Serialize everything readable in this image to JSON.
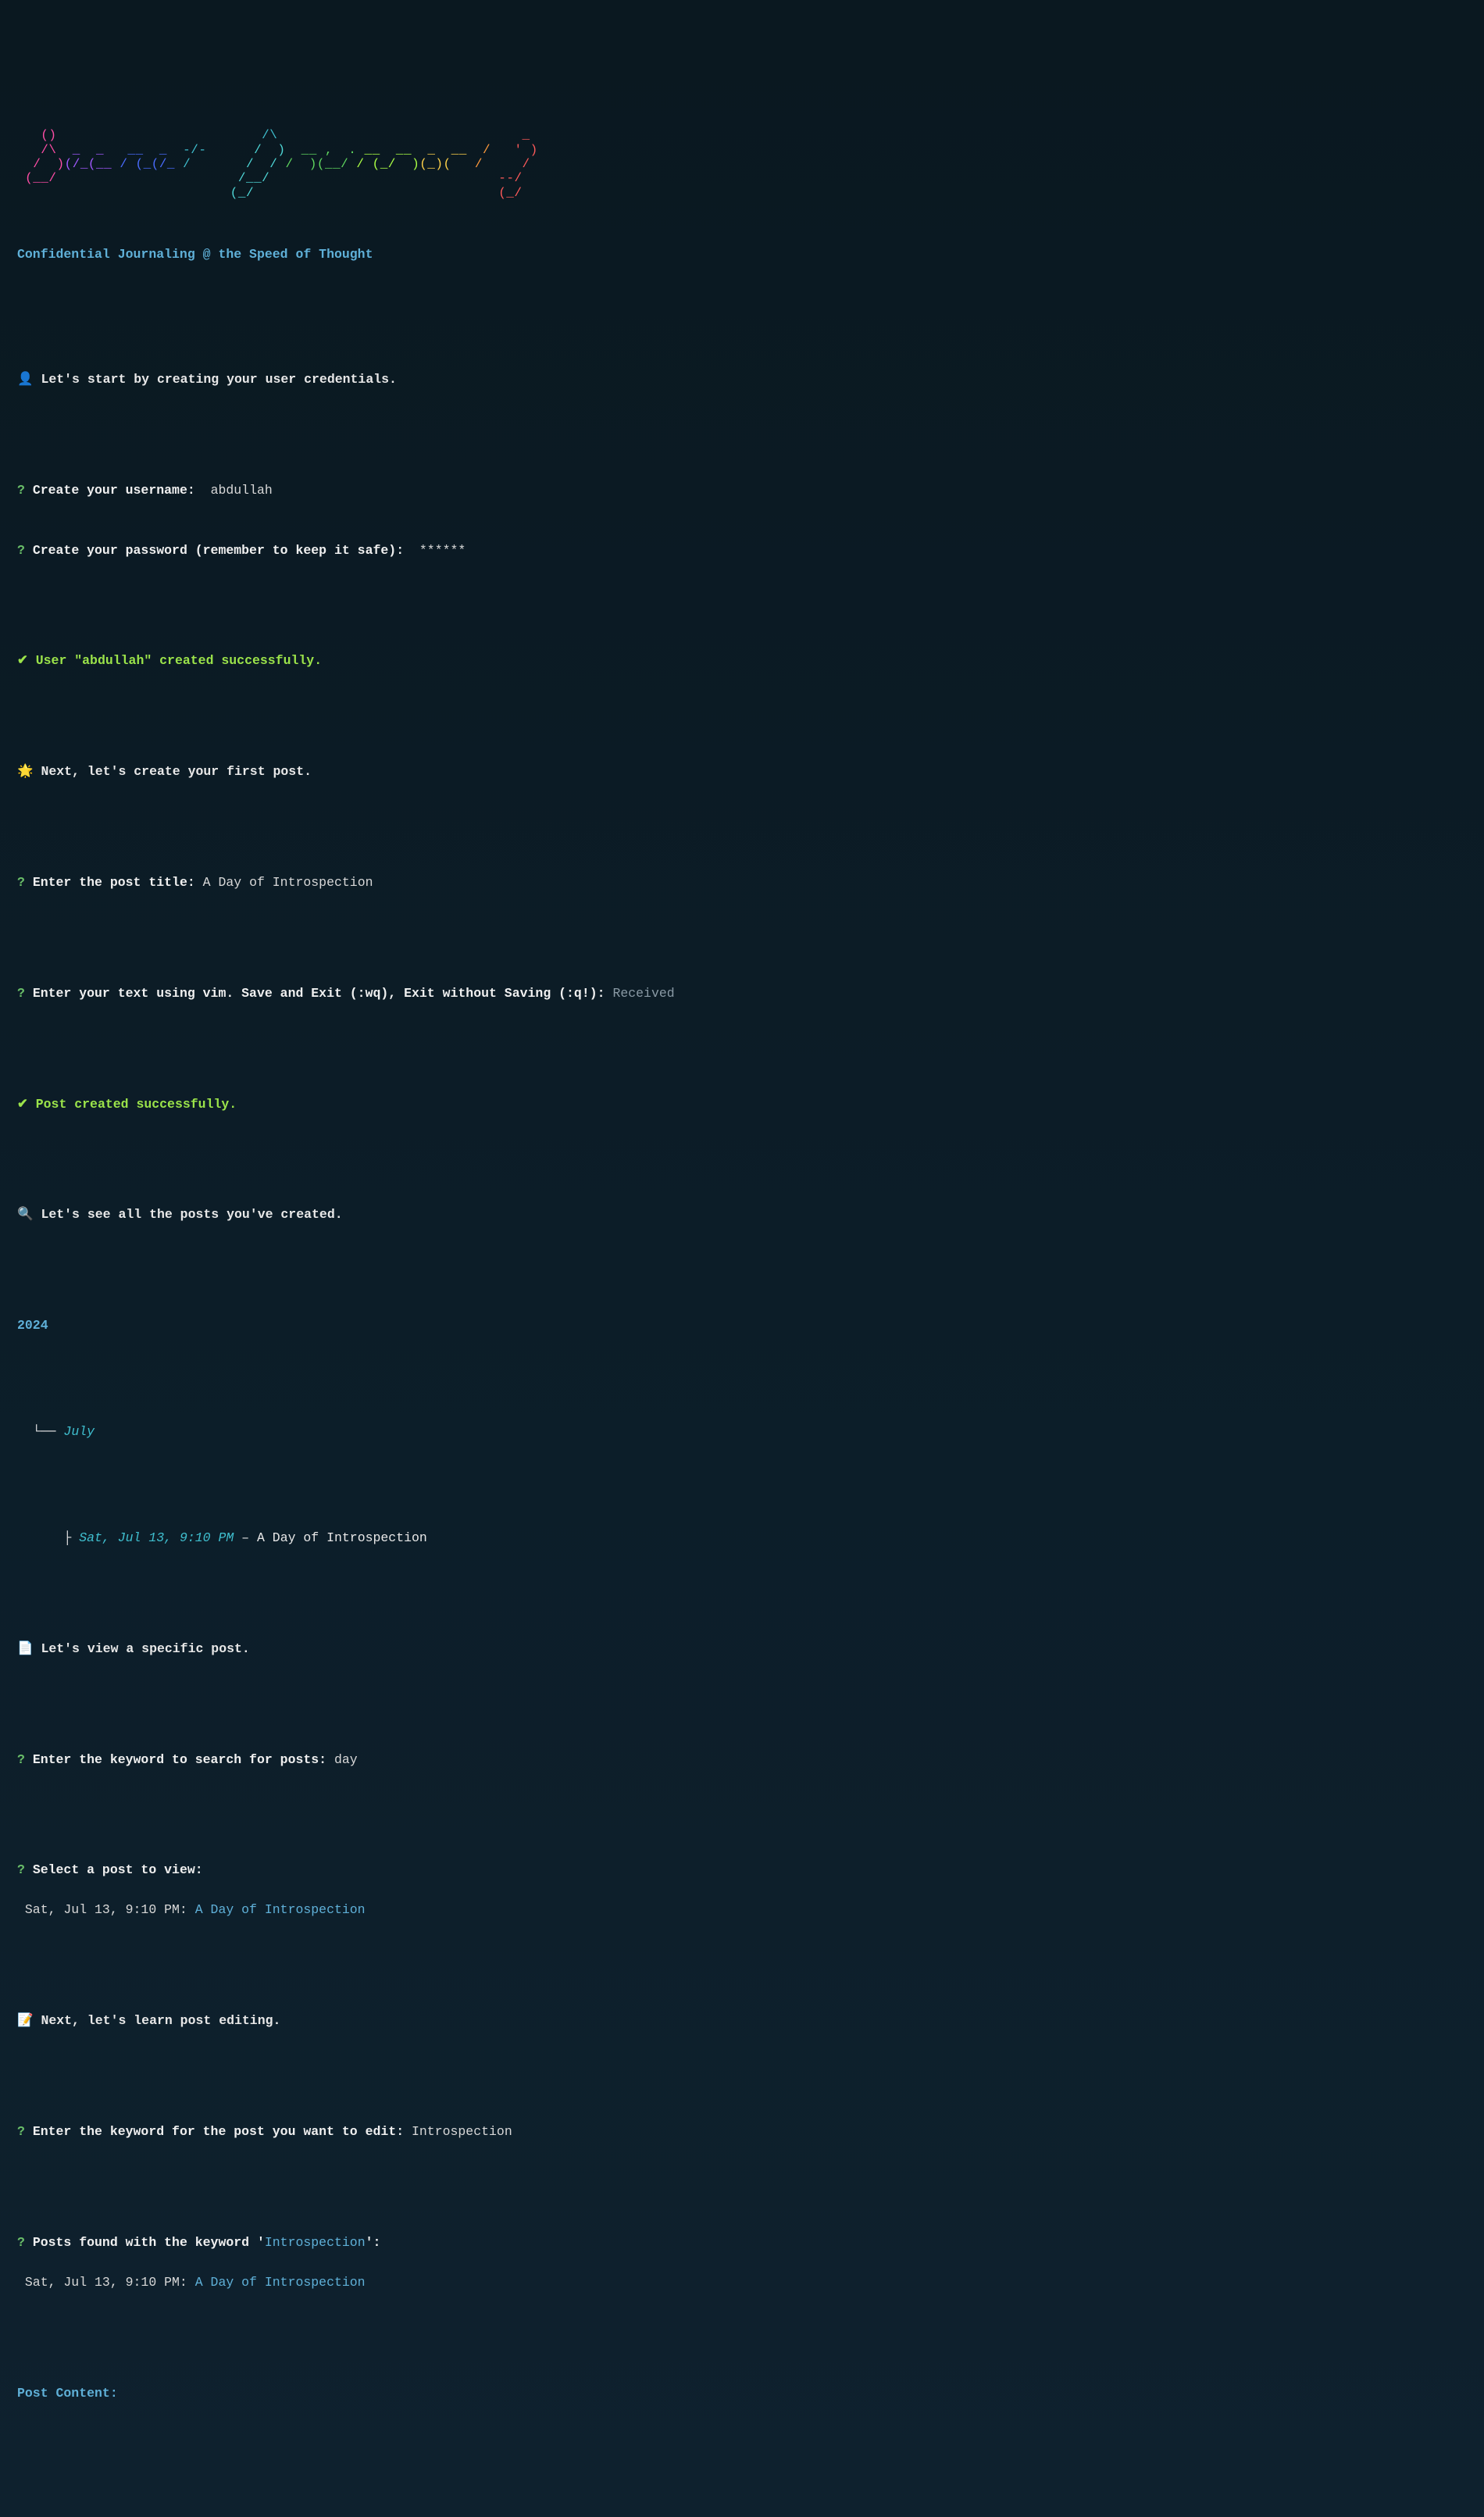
{
  "logo": {
    "lines": [
      "   ()                          /\\                               _",
      "   /\\  _  _   __  _  -/-      /  )  __ ,  . __  __  _  __  /   ' )",
      "  /  )(/_(__ / (_(/_ /       /  / /  )(__/ / (_/  )(_)(   /     /",
      " (__/                       /__/                             --/",
      "                           (_/                               (_/"
    ]
  },
  "subtitle": "Confidential Journaling @ the Speed of Thought",
  "intro": {
    "icon": "👤",
    "text": "Let's start by creating your user credentials."
  },
  "username_prompt": "Create your username:",
  "username_value": "abdullah",
  "password_prompt": "Create your password (remember to keep it safe):",
  "password_value": "******",
  "user_created": "User \"abdullah\" created successfully.",
  "first_post": {
    "icon": "🌟",
    "text": "Next, let's create your first post."
  },
  "post_title_prompt": "Enter the post title:",
  "post_title_value": "A Day of Introspection",
  "vim_prompt": "Enter your text using vim. Save and Exit (:wq), Exit without Saving (:q!):",
  "vim_value": "Received",
  "post_created": "Post created successfully.",
  "view_all": {
    "icon": "🔍",
    "text": "Let's see all the posts you've created."
  },
  "year": "2024",
  "tree_branch_top": "  └── ",
  "month": "July",
  "tree_branch_leaf": "      ├ ",
  "entry_date": "Sat, Jul 13, 9:10 PM",
  "entry_sep": " – ",
  "entry_title": "A Day of Introspection",
  "view_specific": {
    "icon": "📄",
    "text": "Let's view a specific post."
  },
  "search_prompt": "Enter the keyword to search for posts:",
  "search_value": "day",
  "select_prompt": "Select a post to view:",
  "select_date": " Sat, Jul 13, 9:10 PM:",
  "select_title": "A Day of Introspection",
  "edit_intro": {
    "icon": "📝",
    "text": "Next, let's learn post editing."
  },
  "edit_keyword_prompt": "Enter the keyword for the post you want to edit:",
  "edit_keyword_value": "Introspection",
  "found_prefix": "Posts found with the keyword '",
  "found_keyword": "Introspection",
  "found_suffix": "':",
  "found_date": " Sat, Jul 13, 9:10 PM:",
  "found_title": "A Day of Introspection",
  "post_content_label": "Post Content:"
}
